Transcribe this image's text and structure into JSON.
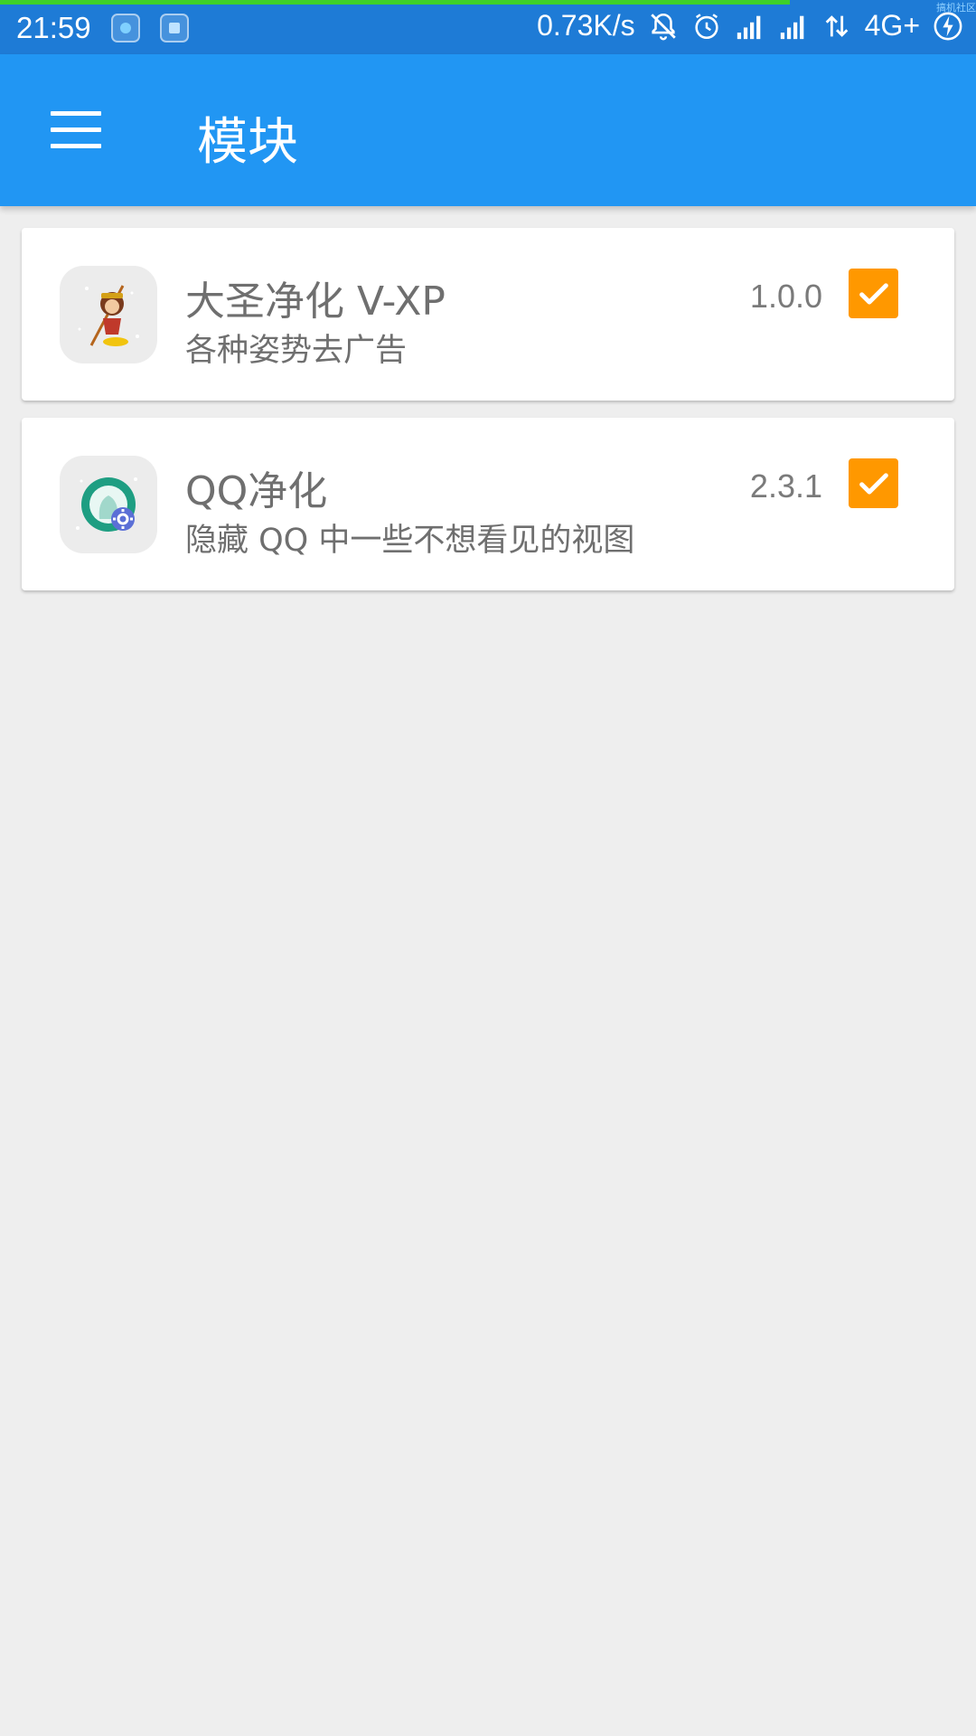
{
  "status_bar": {
    "time": "21:59",
    "net_speed": "0.73K/s",
    "network_type": "4G+",
    "icons": [
      "app-icon-1",
      "app-icon-2",
      "mute-bell-icon",
      "alarm-icon",
      "signal-icon",
      "signal-icon",
      "data-arrows-icon",
      "charging-icon"
    ],
    "watermark": "搞机社区"
  },
  "app_bar": {
    "menu_icon": "hamburger-menu-icon",
    "title": "模块"
  },
  "modules": [
    {
      "name": "大圣净化 V-XP",
      "description": "各种姿势去广告",
      "version": "1.0.0",
      "enabled": true,
      "icon": "monkey-king-icon"
    },
    {
      "name": "QQ净化",
      "description": "隐藏 QQ 中一些不想看见的视图",
      "version": "2.3.1",
      "enabled": true,
      "icon": "qq-purify-icon"
    }
  ],
  "colors": {
    "status_bar": "#1e7bd6",
    "app_bar": "#2196f3",
    "checkbox": "#ff9800",
    "background": "#eeeeee"
  }
}
